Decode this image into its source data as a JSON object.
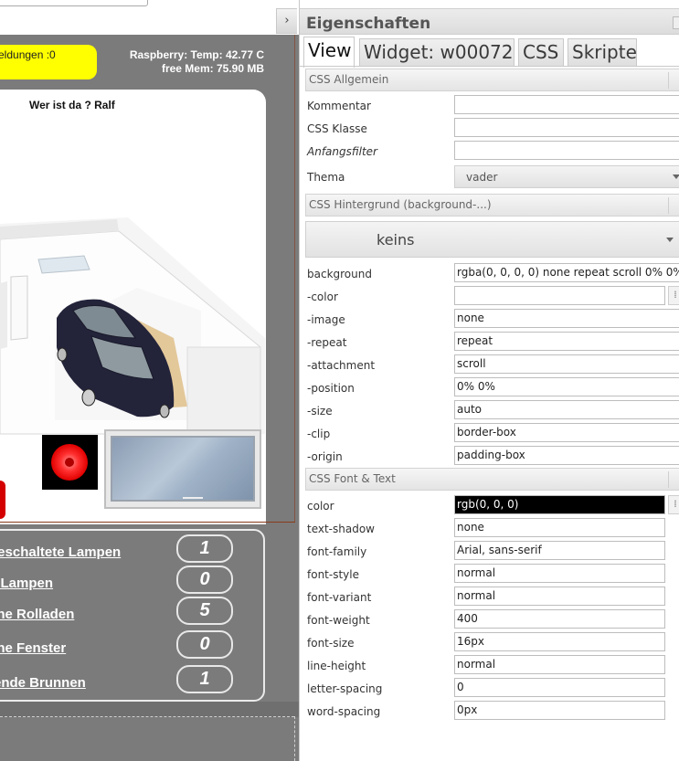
{
  "dashboard": {
    "messages_text": "eldungen :0",
    "raspberry_line1": "Raspberry: Temp: 42.77 C",
    "raspberry_line2": "free Mem: 75.90 MB",
    "who_is_there": "Wer ist da ? Ralf",
    "collapse_icon": "›",
    "stats": [
      {
        "label": "geschaltete Lampen",
        "value": "1"
      },
      {
        "label": "e Lampen",
        "value": "0"
      },
      {
        "label": "ene Rolladen",
        "value": "5"
      },
      {
        "label": "ene Fenster",
        "value": "0"
      },
      {
        "label": "fende Brunnen",
        "value": "1"
      }
    ]
  },
  "panel": {
    "title": "Eigenschaften",
    "tabs": [
      {
        "label": "View",
        "active": true
      },
      {
        "label": "Widget: w00072",
        "active": false
      },
      {
        "label": "CSS",
        "active": false
      },
      {
        "label": "Skripte",
        "active": false
      }
    ],
    "sections": {
      "general": "CSS Allgemein",
      "background": "CSS Hintergrund (background-...)",
      "font": "CSS Font & Text"
    },
    "general_fields": [
      {
        "label": "Kommentar",
        "value": "",
        "italic": false
      },
      {
        "label": "CSS Klasse",
        "value": "",
        "italic": false
      },
      {
        "label": "Anfangsfilter",
        "value": "",
        "italic": true
      }
    ],
    "theme": {
      "label": "Thema",
      "value": "vader"
    },
    "background_preset": "keins",
    "background_fields": [
      {
        "label": "background",
        "value": "rgba(0, 0, 0, 0) none repeat scroll 0% 0%"
      },
      {
        "label": "-color",
        "value": ""
      },
      {
        "label": "-image",
        "value": "none"
      },
      {
        "label": "-repeat",
        "value": "repeat"
      },
      {
        "label": "-attachment",
        "value": "scroll"
      },
      {
        "label": "-position",
        "value": "0% 0%"
      },
      {
        "label": "-size",
        "value": "auto"
      },
      {
        "label": "-clip",
        "value": "border-box"
      },
      {
        "label": "-origin",
        "value": "padding-box"
      }
    ],
    "font_fields": [
      {
        "label": "color",
        "value": "rgb(0, 0, 0)"
      },
      {
        "label": "text-shadow",
        "value": "none"
      },
      {
        "label": "font-family",
        "value": "Arial, sans-serif"
      },
      {
        "label": "font-style",
        "value": "normal"
      },
      {
        "label": "font-variant",
        "value": "normal"
      },
      {
        "label": "font-weight",
        "value": "400"
      },
      {
        "label": "font-size",
        "value": "16px"
      },
      {
        "label": "line-height",
        "value": "normal"
      },
      {
        "label": "letter-spacing",
        "value": "0"
      },
      {
        "label": "word-spacing",
        "value": "0px"
      }
    ],
    "colors": {
      "message_pill": "#ffff00",
      "record_button": "#e10000",
      "canvas_bg": "#7b7b7b"
    }
  }
}
